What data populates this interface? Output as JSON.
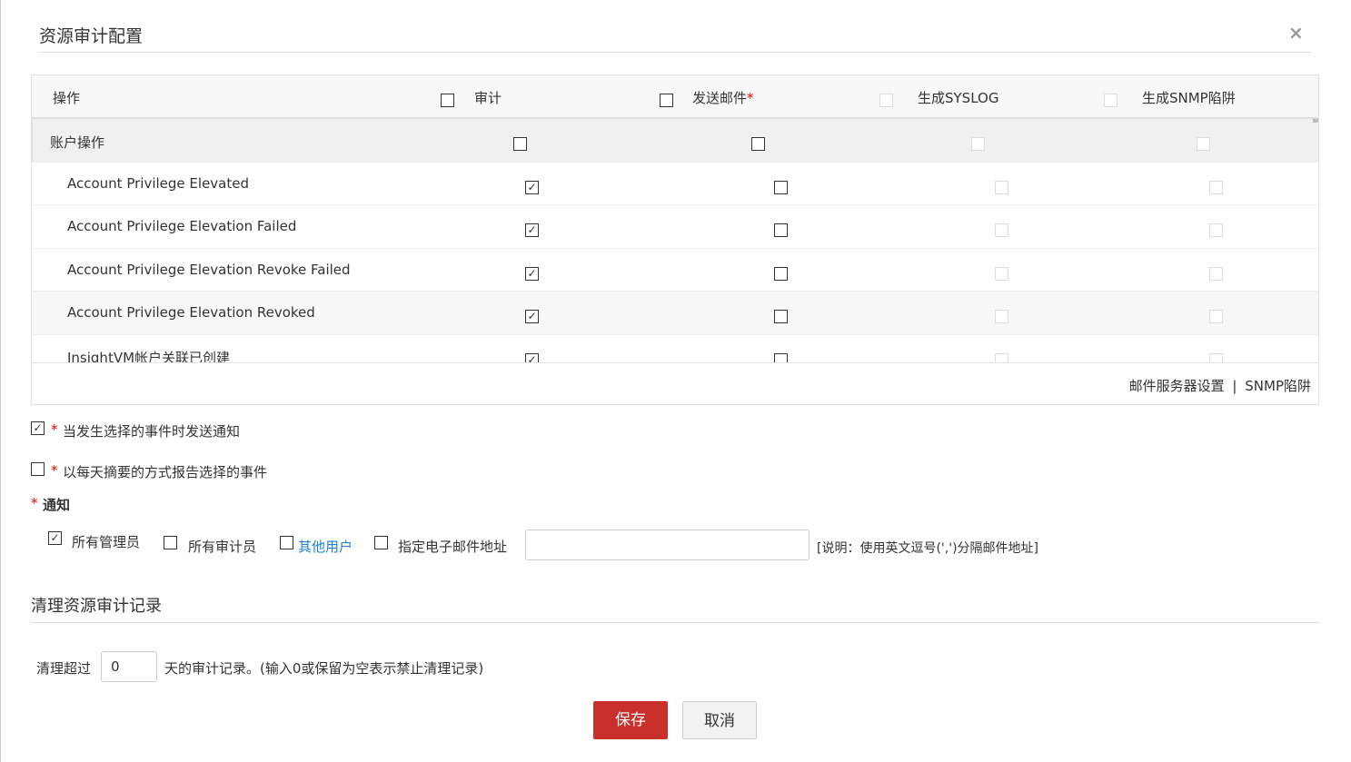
{
  "dialog": {
    "title": "资源审计配置",
    "close": "×"
  },
  "table": {
    "headers": {
      "operation": "操作",
      "audit": "审计",
      "email": "发送邮件",
      "email_required": "*",
      "syslog": "生成SYSLOG",
      "snmp": "生成SNMP陷阱"
    },
    "group": {
      "label": "账户操作"
    },
    "rows": [
      {
        "label": "Account Privilege Elevated",
        "audit": true,
        "email": false
      },
      {
        "label": "Account Privilege Elevation Failed",
        "audit": true,
        "email": false
      },
      {
        "label": "Account Privilege Elevation Revoke Failed",
        "audit": true,
        "email": false
      },
      {
        "label": "Account Privilege Elevation Revoked",
        "audit": true,
        "email": false
      },
      {
        "label": "InsightVM帐户关联已创建",
        "audit": true,
        "email": false
      }
    ],
    "footer": {
      "mail_settings": "邮件服务器设置",
      "separator": "|",
      "snmp_trap": "SNMP陷阱"
    }
  },
  "options": {
    "notify_on_event": {
      "label": "当发生选择的事件时发送通知",
      "checked": true
    },
    "daily_digest": {
      "label": "以每天摘要的方式报告选择的事件",
      "checked": false
    },
    "required_mark": "*"
  },
  "notify": {
    "label": "通知",
    "all_admins": {
      "label": "所有管理员",
      "checked": true
    },
    "all_auditors": {
      "label": "所有审计员",
      "checked": false
    },
    "other_users": {
      "label": "其他用户",
      "checked": false
    },
    "specific_email": {
      "label": "指定电子邮件地址",
      "checked": false,
      "value": ""
    },
    "hint": "[说明：使用英文逗号(',')分隔邮件地址]"
  },
  "cleanup": {
    "section_title": "清理资源审计记录",
    "prefix": "清理超过",
    "days": "0",
    "suffix": "天的审计记录。(输入0或保留为空表示禁止清理记录)"
  },
  "buttons": {
    "save": "保存",
    "cancel": "取消"
  },
  "colors": {
    "primary": "#c9302c",
    "link": "#1a7fd4",
    "required": "#e00"
  }
}
